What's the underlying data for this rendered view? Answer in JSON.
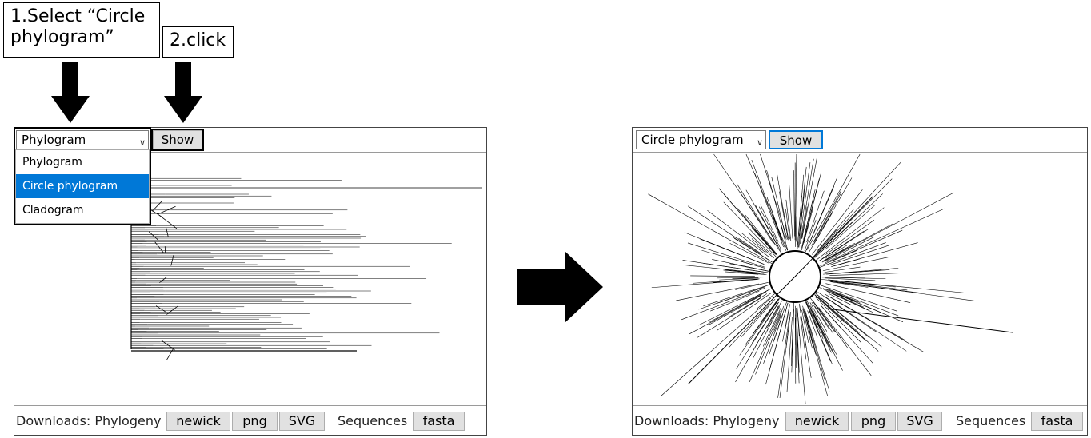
{
  "callouts": {
    "step1": "1.Select “Circle phylogram”",
    "step2": "2.click"
  },
  "left_panel": {
    "select_value": "Phylogram",
    "show_label": "Show",
    "dropdown_options": [
      "Phylogram",
      "Circle phylogram",
      "Cladogram"
    ],
    "dropdown_highlighted": "Circle phylogram"
  },
  "right_panel": {
    "select_value": "Circle phylogram",
    "show_label": "Show"
  },
  "downloads": {
    "label": "Downloads: Phylogeny",
    "newick": "newick",
    "png": "png",
    "svg": "SVG",
    "sequences_label": "Sequences",
    "fasta": "fasta"
  },
  "colors": {
    "selection": "#0078d7",
    "button_bg": "#e1e1e1",
    "focus_border": "#0078d7"
  },
  "icons": {
    "dropdown": "chevron-down-icon",
    "step_arrow": "down-arrow-icon",
    "transition": "right-arrow-icon"
  }
}
